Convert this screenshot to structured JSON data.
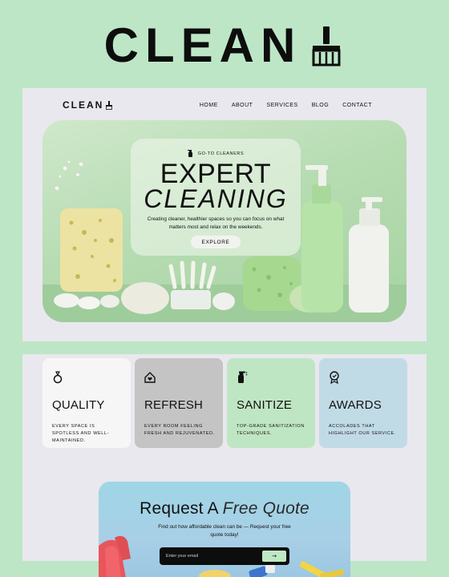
{
  "brand": {
    "title": "CLEAN"
  },
  "site": {
    "logo": "CLEAN",
    "menu": [
      "HOME",
      "ABOUT",
      "SERVICES",
      "BLOG",
      "CONTACT"
    ]
  },
  "hero": {
    "kicker": "GO-TO CLEANERS",
    "title_line1": "EXPERT",
    "title_line2": "CLEANING",
    "description": "Creating cleaner, healthier spaces so you can focus on what matters most and relax on the weekends.",
    "cta": "EXPLORE"
  },
  "features": [
    {
      "icon": "hand-bell-icon",
      "title": "QUALITY",
      "desc": "EVERY SPACE IS SPOTLESS AND WELL-MAINTAINED."
    },
    {
      "icon": "home-heart-icon",
      "title": "REFRESH",
      "desc": "EVERY ROOM FEELING FRESH AND REJUVENATED."
    },
    {
      "icon": "spray-bottle-icon",
      "title": "SANITIZE",
      "desc": "TOP-GRADE SANITIZATION TECHNIQUES."
    },
    {
      "icon": "award-badge-icon",
      "title": "AWARDS",
      "desc": "ACCOLADES THAT HIGHLIGHT OUR SERVICE."
    }
  ],
  "quote": {
    "title_plain": "Request A",
    "title_italic": "Free Quote",
    "description": "Find out how affordable clean can be — Request your free quote today!",
    "email_placeholder": "Enter your email",
    "submit": "→"
  },
  "colors": {
    "background": "#bde6c6",
    "panel": "#e9e8ee",
    "card_quality": "#f6f6f6",
    "card_refresh": "#c4c4c4",
    "card_sanitize": "#bfe6c3",
    "card_awards": "#c1dbe6",
    "quote_bg": "#a6d1e6"
  }
}
